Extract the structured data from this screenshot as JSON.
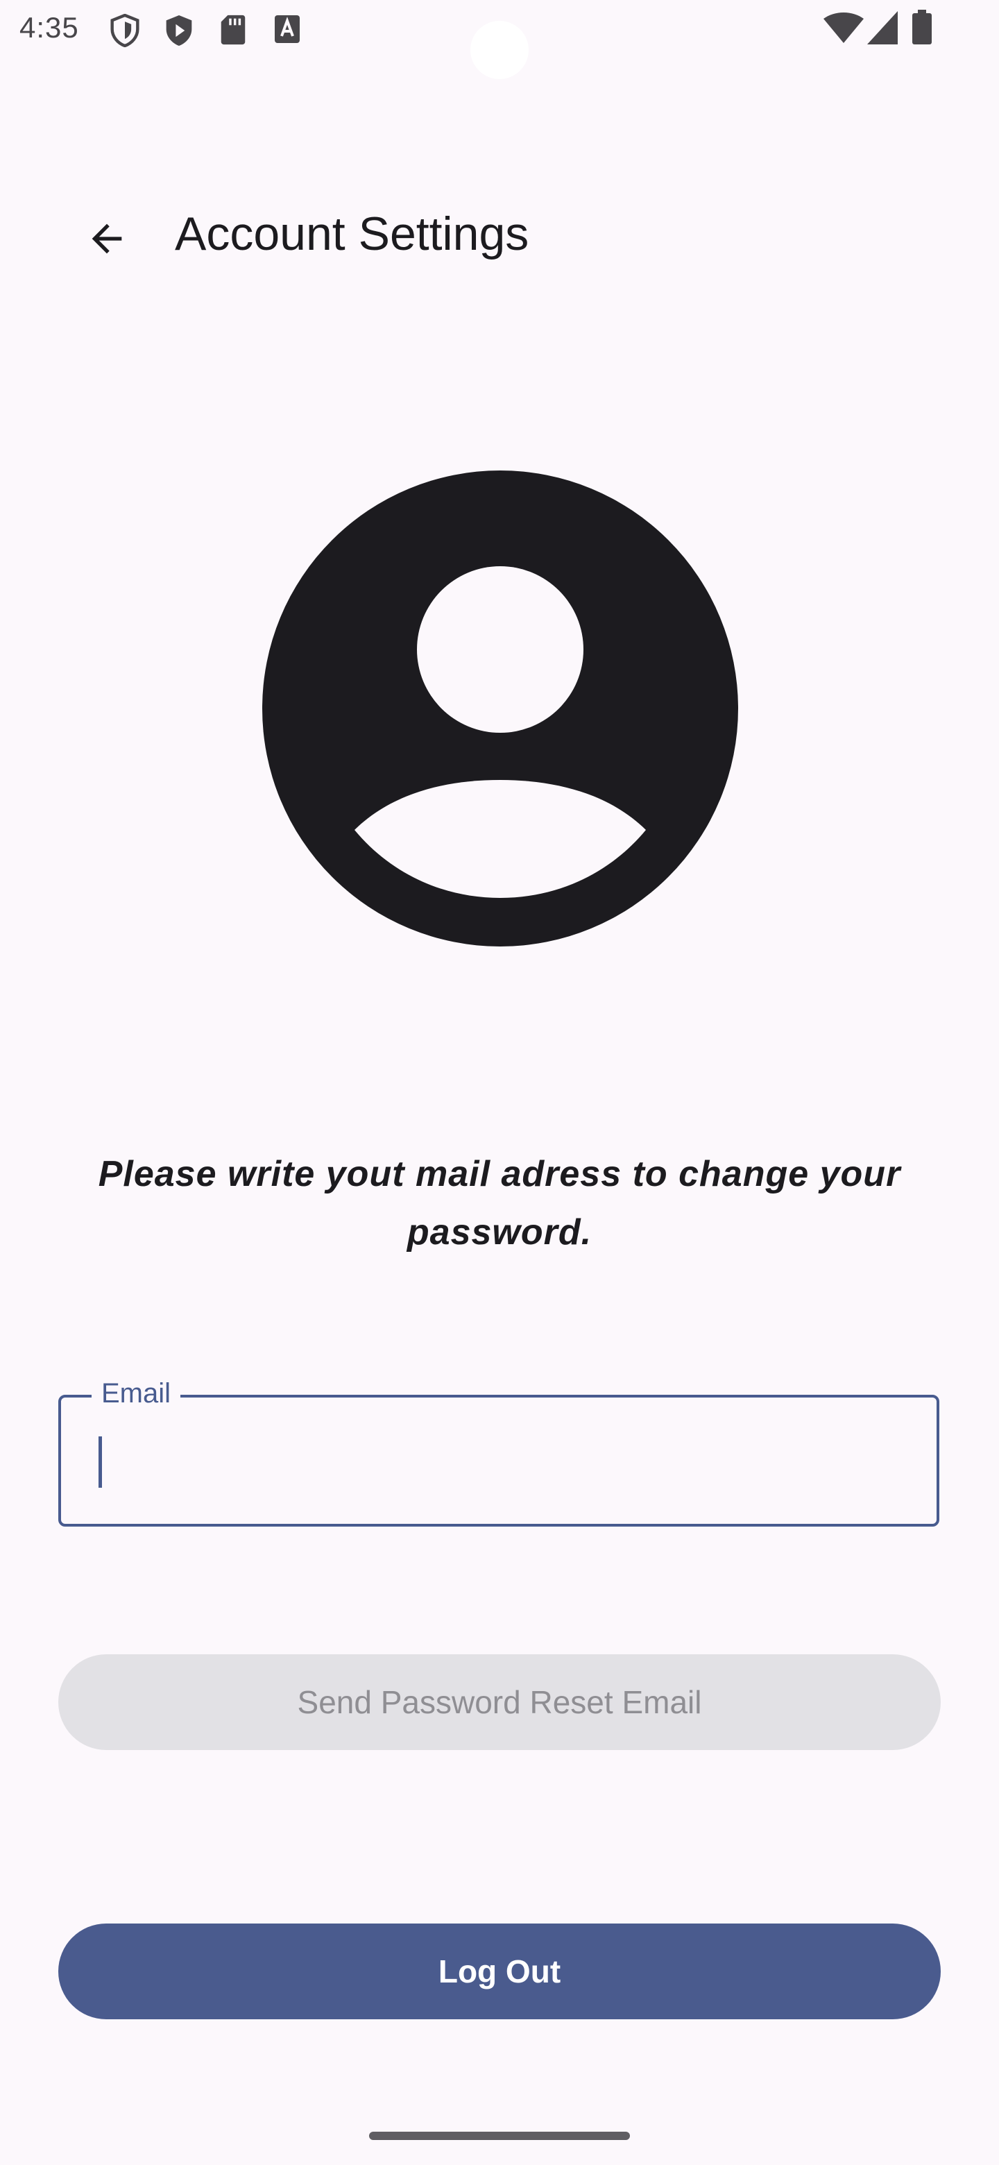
{
  "status_bar": {
    "time": "4:35",
    "left_icons": [
      "shield-outline-icon",
      "shield-play-icon",
      "sd-card-icon",
      "text-a-icon"
    ],
    "right_icons": [
      "wifi-icon",
      "cell-signal-icon",
      "battery-icon"
    ]
  },
  "app_bar": {
    "title": "Account Settings",
    "back_icon": "arrow-back-icon"
  },
  "profile": {
    "avatar_icon": "account-circle-icon",
    "avatar_color": "#1c1b1f"
  },
  "message": "Please write yout mail adress to change your password.",
  "email_field": {
    "label": "Email",
    "value": ""
  },
  "buttons": {
    "reset_label": "Send Password Reset Email",
    "logout_label": "Log Out"
  },
  "colors": {
    "primary": "#4a5b8e",
    "background": "#fcf8fc",
    "disabled_bg": "#e2e1e5",
    "disabled_text": "#8f8e93"
  }
}
